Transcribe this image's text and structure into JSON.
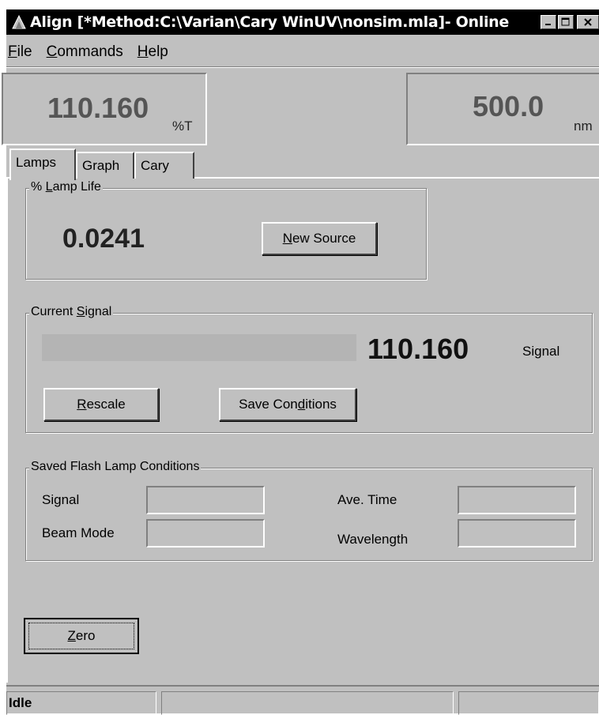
{
  "window": {
    "title": "Align [*Method:C:\\Varian\\Cary WinUV\\nonsim.mla]- Online",
    "icon": "app-lamp-icon"
  },
  "menu": {
    "items": [
      {
        "label": "File",
        "accel": "F",
        "rest": "ile"
      },
      {
        "label": "Commands",
        "accel": "C",
        "rest": "ommands"
      },
      {
        "label": "Help",
        "accel": "H",
        "rest": "elp"
      }
    ]
  },
  "readouts": {
    "transmittance": {
      "value": "110.160",
      "unit": "%T"
    },
    "wavelength": {
      "value": "500.0",
      "unit": "nm"
    }
  },
  "tabs": [
    {
      "label": "Lamps",
      "active": true
    },
    {
      "label": "Graph",
      "active": false
    },
    {
      "label": "Cary",
      "active": false
    }
  ],
  "lamp_life": {
    "legend": "% Lamp Life",
    "legend_accel": "L",
    "value": "0.0241",
    "new_source": {
      "accel": "N",
      "rest": "ew Source"
    }
  },
  "current_signal": {
    "legend_pre": "Current ",
    "legend_accel": "S",
    "legend_post": "ignal",
    "value": "110.160",
    "value_label": "Signal",
    "rescale": {
      "accel": "R",
      "rest": "escale"
    },
    "save_conditions": {
      "pre": "Save Con",
      "accel": "d",
      "post": "itions"
    }
  },
  "saved_conditions": {
    "legend": "Saved Flash Lamp Conditions",
    "labels": {
      "signal": "Signal",
      "beam_mode": "Beam Mode",
      "ave_time": "Ave. Time",
      "wavelength": "Wavelength"
    },
    "values": {
      "signal": "",
      "beam_mode": "",
      "ave_time": "",
      "wavelength": ""
    }
  },
  "zero_button": {
    "accel": "Z",
    "rest": "ero"
  },
  "status": {
    "state": "Idle",
    "cell2": "",
    "cell3": ""
  }
}
